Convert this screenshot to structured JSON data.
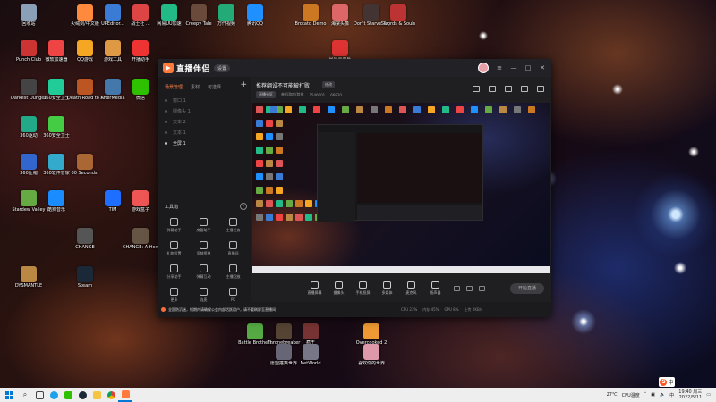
{
  "desktop": {
    "icons": [
      {
        "label": "回收站",
        "icon": "recycle-bin-icon",
        "color": "#8aa0b8"
      },
      {
        "label": "火绒剑/中文版",
        "icon": "app-icon",
        "color": "#ff8a3d"
      },
      {
        "label": "UPEditor...",
        "icon": "app-icon",
        "color": "#3a7bd5"
      },
      {
        "label": "战士社 ...",
        "icon": "app-icon",
        "color": "#d44"
      },
      {
        "label": "网易UU加速",
        "icon": "app-icon",
        "color": "#2b8"
      },
      {
        "label": "Creepy Tale",
        "icon": "game-icon",
        "color": "#6a4a3a"
      },
      {
        "label": "万仟视频",
        "icon": "app-icon",
        "color": "#2a7"
      },
      {
        "label": "腾讯QQ",
        "icon": "qq-icon",
        "color": "#1e90ff"
      },
      {
        "label": "Punch Club",
        "icon": "game-icon",
        "color": "#c33"
      },
      {
        "label": "微软加速器",
        "icon": "app-icon",
        "color": "#e44"
      },
      {
        "label": "QQ游戏",
        "icon": "app-icon",
        "color": "#f5a623"
      },
      {
        "label": "游戏工具",
        "icon": "app-icon",
        "color": "#d94"
      },
      {
        "label": "开播助手",
        "icon": "app-icon",
        "color": "#e33"
      },
      {
        "label": "Darkest Dungeon",
        "icon": "game-icon",
        "color": "#444"
      },
      {
        "label": "360安全卫士",
        "icon": "app-icon",
        "color": "#2c9"
      },
      {
        "label": "Death Road to Canada",
        "icon": "game-icon",
        "color": "#b52"
      },
      {
        "label": "AfterMedia",
        "icon": "app-icon",
        "color": "#47a"
      },
      {
        "label": "微信",
        "icon": "wechat-icon",
        "color": "#2dc100"
      },
      {
        "label": "360驱动",
        "icon": "app-icon",
        "color": "#2a8"
      },
      {
        "label": "360安全卫士",
        "icon": "app-icon",
        "color": "#4c4"
      },
      {
        "label": "360压缩",
        "icon": "app-icon",
        "color": "#36c"
      },
      {
        "label": "360软件管家",
        "icon": "app-icon",
        "color": "#3ac"
      },
      {
        "label": "60 Seconds!",
        "icon": "game-icon",
        "color": "#a63"
      },
      {
        "label": "Stardew Valley",
        "icon": "game-icon",
        "color": "#6a4"
      },
      {
        "label": "酷狗音乐",
        "icon": "app-icon",
        "color": "#1a8cff"
      },
      {
        "label": "TIM",
        "icon": "app-icon",
        "color": "#1e6fff"
      },
      {
        "label": "游戏盒子",
        "icon": "app-icon",
        "color": "#e55"
      },
      {
        "label": "CHANGE",
        "icon": "game-icon",
        "color": "#555"
      },
      {
        "label": "DYSMANTLE",
        "icon": "game-icon",
        "color": "#b84"
      },
      {
        "label": "Steam",
        "icon": "steam-icon",
        "color": "#1b2838"
      },
      {
        "label": "CHANGE: A Homeless...",
        "icon": "game-icon",
        "color": "#654"
      },
      {
        "label": "Brotato Demo",
        "icon": "game-icon",
        "color": "#c72"
      },
      {
        "label": "海棠头像",
        "icon": "app-icon",
        "color": "#d66"
      },
      {
        "label": "Don't Starve Together",
        "icon": "game-icon",
        "color": "#433"
      },
      {
        "label": "Swords & Souls",
        "icon": "game-icon",
        "color": "#b33"
      },
      {
        "label": "网易云音乐",
        "icon": "app-icon",
        "color": "#d33"
      },
      {
        "label": "Battle Brothers",
        "icon": "game-icon",
        "color": "#5a4"
      },
      {
        "label": "Thronebreaker",
        "icon": "game-icon",
        "color": "#543"
      },
      {
        "label": "疯王",
        "icon": "game-icon",
        "color": "#733"
      },
      {
        "label": "Overcooked 2",
        "icon": "game-icon",
        "color": "#e93"
      },
      {
        "label": "愿望搭乘世界",
        "icon": "game-icon",
        "color": "#667"
      },
      {
        "label": "NetWorld",
        "icon": "app-icon",
        "color": "#778"
      },
      {
        "label": "喜欢你的世界",
        "icon": "game-icon",
        "color": "#d9a"
      }
    ]
  },
  "app": {
    "brand": "直播伴侣",
    "version_pill": "设置",
    "room_title": "推荐翻设不可能被打败",
    "edit_label": "修改",
    "meta": {
      "tag": "直播分区",
      "category": "单机游戏/其他",
      "room_id": "7540001",
      "likes": "66820"
    },
    "side_tabs": [
      "场景管理",
      "素材",
      "可选择"
    ],
    "scenes": [
      "窗口 1",
      "摄像头 1",
      "文本 2",
      "文本 1",
      "全屏 1"
    ],
    "tools_title": "工具箱",
    "tools": [
      "弹幕助手",
      "房管助手",
      "主播任务",
      "礼物设置",
      "贡献榜单",
      "直播间",
      "分享助手",
      "弹幕互动",
      "主播回放",
      "更多",
      "连麦",
      "PK"
    ],
    "toolbar": [
      "直播屏幕",
      "摄像头",
      "手机投屏",
      "多媒体",
      "麦克风",
      "扬声器"
    ],
    "start_live": "开始直播",
    "notice": "全国防沉迷，短期内请确保公会内部活跃用户，请不要刷屏至直播间",
    "stats": [
      "CPU 23%",
      "内存 45%",
      "GPU 8%",
      "上传 0KB/s"
    ]
  },
  "taskbar": {
    "apps": [
      "search",
      "task-view",
      "edge",
      "wechat",
      "steam",
      "folder",
      "chrome",
      "live-app"
    ],
    "tray": {
      "lang": "中",
      "weather": "27℃",
      "weather_desc": "CPU温度",
      "time": "19:40 周三",
      "date": "2022/5/11"
    }
  },
  "colors": {
    "accent": "#ff7f45",
    "window_bg": "#1f1f22",
    "taskbar_bg": "#eeeeee"
  }
}
